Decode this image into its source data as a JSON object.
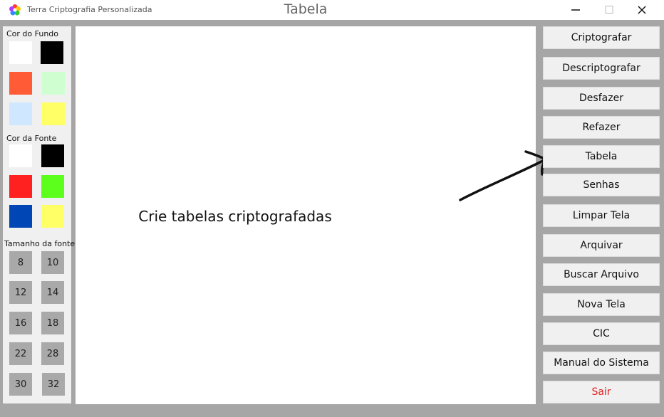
{
  "window": {
    "app_title": "Terra Criptografia Personalizada",
    "caption": "Tabela",
    "controls": [
      "minimize-icon",
      "maximize-icon",
      "close-icon"
    ]
  },
  "left_panel": {
    "bg_color_label": "Cor do Fundo",
    "bg_colors": [
      "#ffffff",
      "#000000",
      "#ff5b37",
      "#cfffd0",
      "#cfe8ff",
      "#ffff66"
    ],
    "font_color_label": "Cor da Fonte",
    "font_colors": [
      "#ffffff",
      "#000000",
      "#ff2020",
      "#5cff1c",
      "#0046b4",
      "#ffff66"
    ],
    "font_size_label": "Tamanho da fonte",
    "font_sizes": [
      "8",
      "10",
      "12",
      "14",
      "16",
      "18",
      "22",
      "28",
      "30",
      "32"
    ]
  },
  "canvas": {
    "text": "Crie tabelas criptografadas"
  },
  "menu": {
    "buttons": [
      "Criptografar",
      "Descriptografar",
      "Desfazer",
      "Refazer",
      "Tabela",
      "Senhas",
      "Limpar Tela",
      "Arquivar",
      "Buscar Arquivo",
      "Nova Tela",
      "CIC",
      "Manual do Sistema",
      "Sair"
    ]
  },
  "colors": {
    "exit_text": "#e02020",
    "background": "#a6a6a6"
  }
}
